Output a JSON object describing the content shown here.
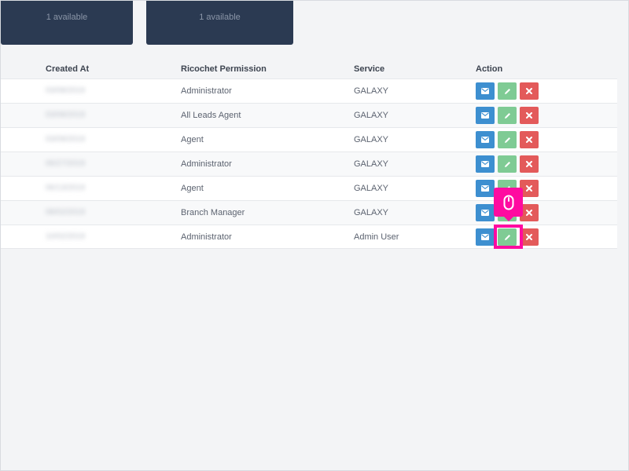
{
  "cards": [
    {
      "subtitle": "1 available"
    },
    {
      "subtitle": "1 available"
    }
  ],
  "table": {
    "headers": {
      "created_at": "Created At",
      "permission": "Ricochet Permission",
      "service": "Service",
      "action": "Action"
    },
    "rows": [
      {
        "created_at": "03/08/2019",
        "permission": "Administrator",
        "service": "GALAXY"
      },
      {
        "created_at": "03/08/2019",
        "permission": "All Leads Agent",
        "service": "GALAXY"
      },
      {
        "created_at": "03/09/2019",
        "permission": "Agent",
        "service": "GALAXY"
      },
      {
        "created_at": "06/27/2019",
        "permission": "Administrator",
        "service": "GALAXY"
      },
      {
        "created_at": "06/13/2019",
        "permission": "Agent",
        "service": "GALAXY"
      },
      {
        "created_at": "08/02/2019",
        "permission": "Branch Manager",
        "service": "GALAXY"
      },
      {
        "created_at": "10/02/2019",
        "permission": "Administrator",
        "service": "Admin User"
      }
    ]
  },
  "icons": {
    "mail": "envelope-icon",
    "edit": "pencil-icon",
    "delete": "close-icon",
    "click": "mouse-icon"
  },
  "colors": {
    "card_bg": "#2b3a52",
    "mail_button": "#3d8fd0",
    "edit_button": "#7fcb94",
    "delete_button": "#e35a5a",
    "highlight": "#ff0aa0"
  }
}
